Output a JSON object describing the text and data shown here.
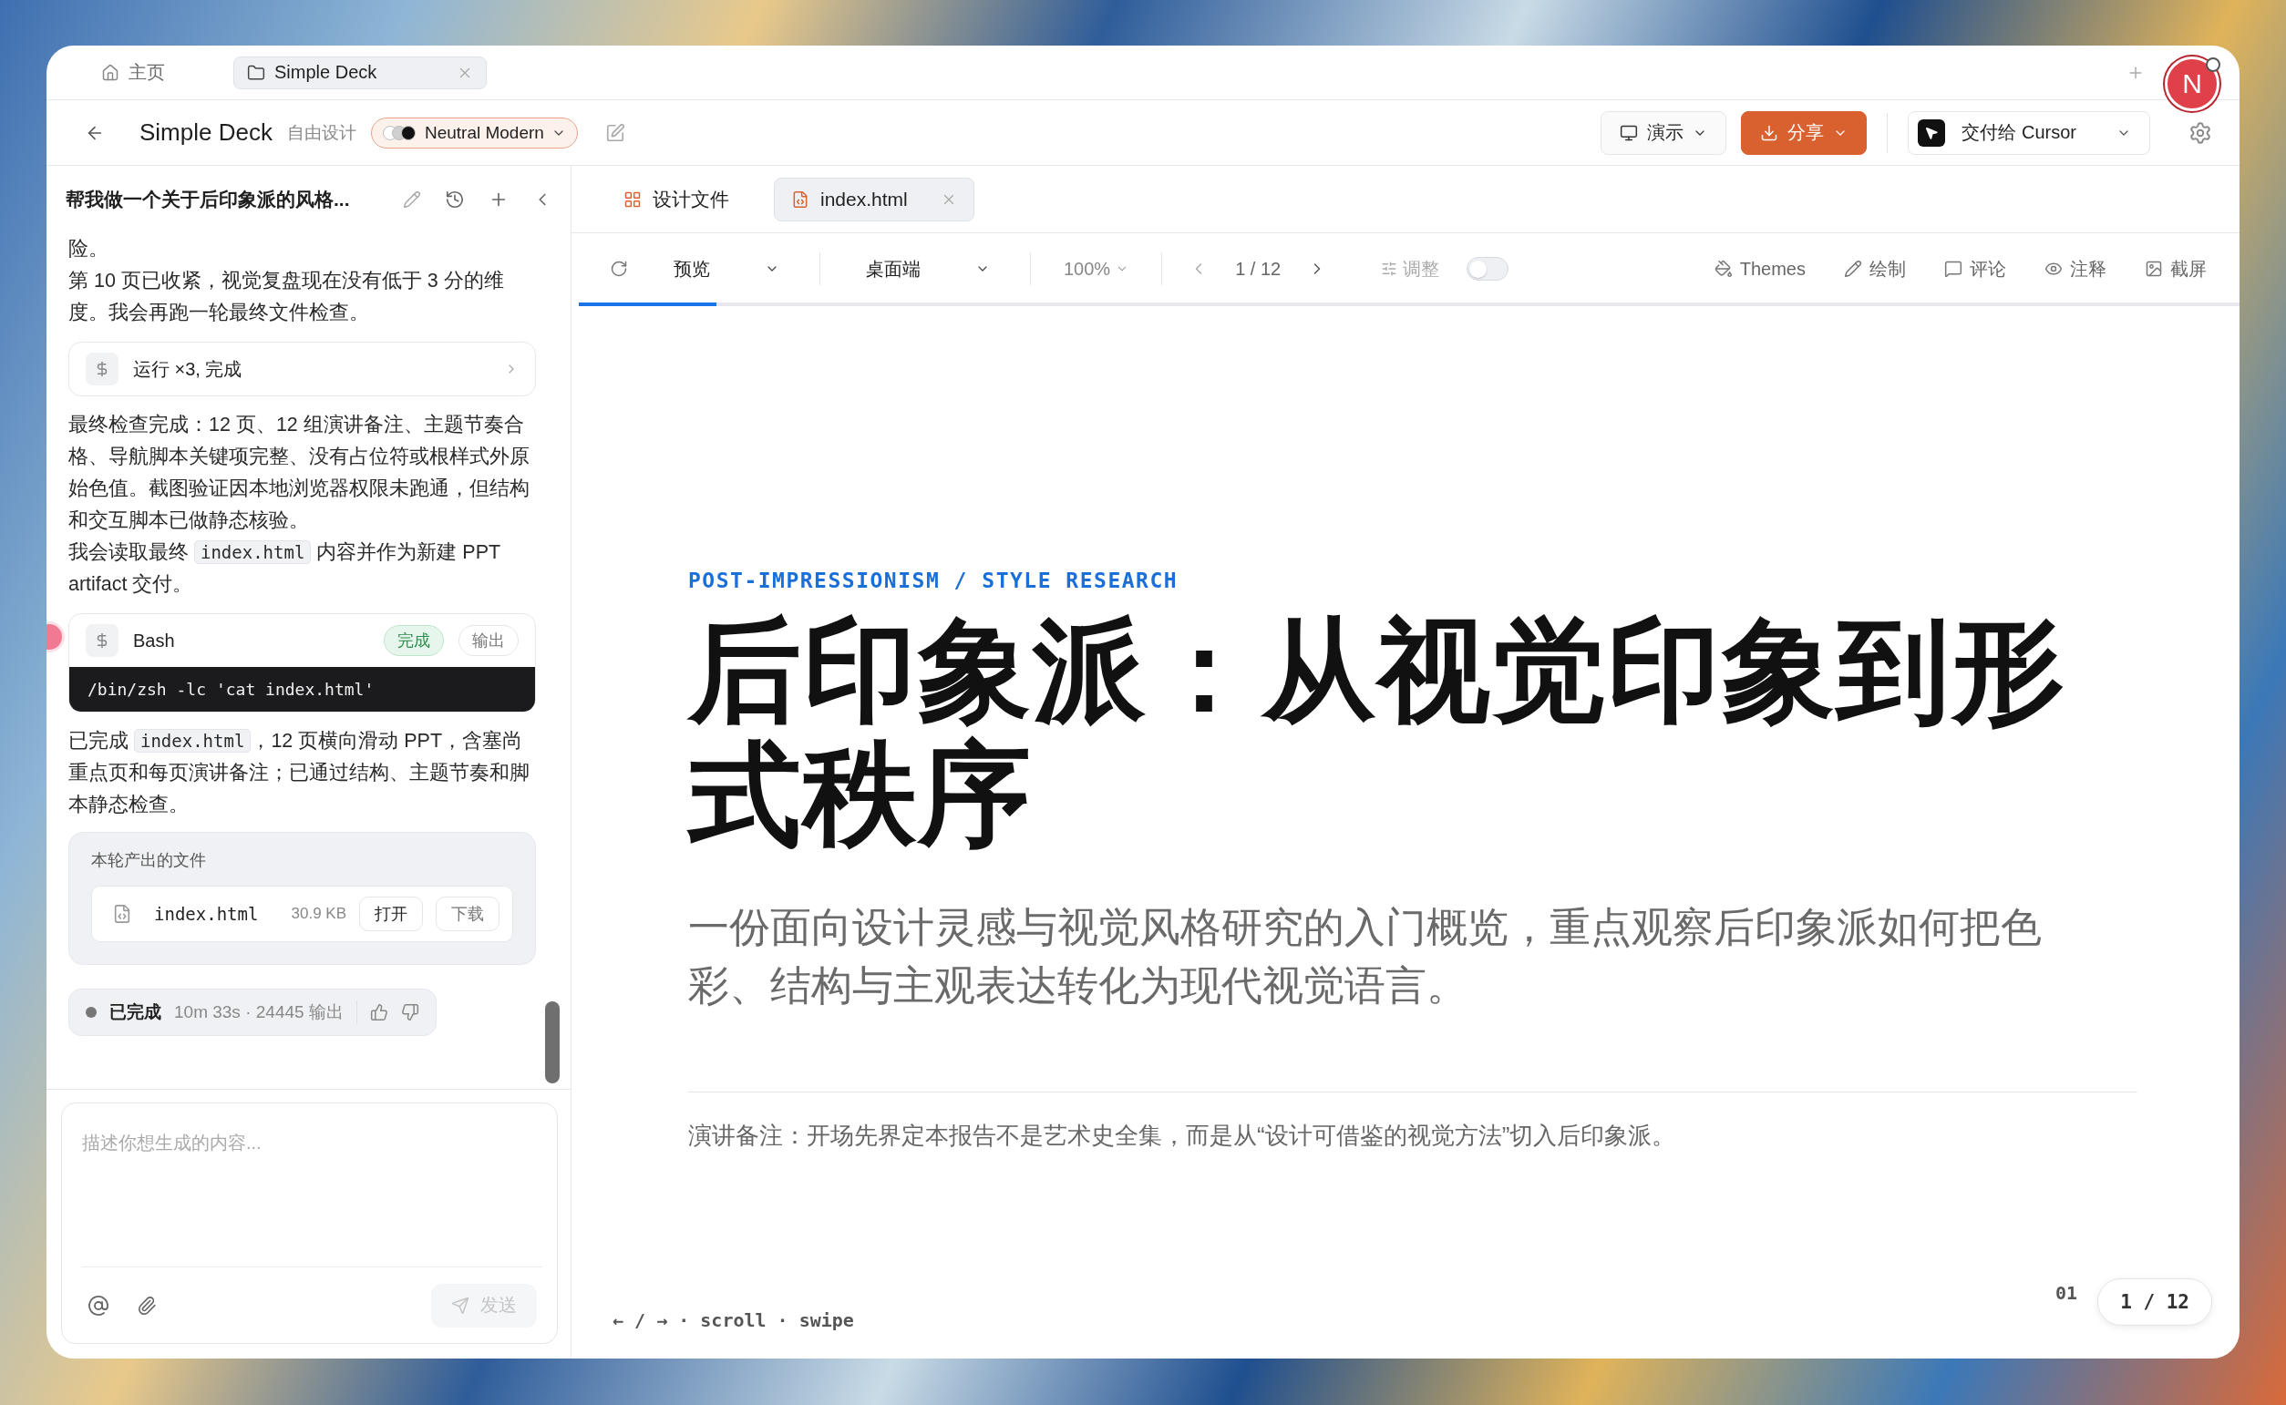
{
  "browser_tabs": [
    {
      "label": "主页",
      "selected": false
    },
    {
      "label": "Simple Deck",
      "selected": true
    }
  ],
  "header": {
    "title": "Simple Deck",
    "mode": "自由设计",
    "theme": {
      "name": "Neutral Modern",
      "swatches": [
        {
          "color": "#ffffff"
        },
        {
          "color": "#cfcfcf"
        },
        {
          "color": "#111111"
        }
      ]
    },
    "present": {
      "label": "演示"
    },
    "share": {
      "label": "分享"
    },
    "deliver": {
      "label": "交付给 Cursor"
    },
    "avatar": "N"
  },
  "chat": {
    "title": "帮我做一个关于后印象派的风格...",
    "messages": [
      {
        "kind": "text",
        "parts": [
          {
            "kind": "text",
            "text": "险。"
          }
        ]
      },
      {
        "kind": "text",
        "parts": [
          {
            "kind": "text",
            "text": "第 10 页已收紧，视觉复盘现在没有低于 3 分的维度。我会再跑一轮最终文件检查。"
          }
        ]
      },
      {
        "kind": "tool",
        "label": "运行 ×3, 完成"
      },
      {
        "kind": "text",
        "parts": [
          {
            "kind": "text",
            "text": "最终检查完成：12 页、12 组演讲备注、主题节奏合格、导航脚本关键项完整、没有占位符或根样式外原始色值。截图验证因本地浏览器权限未跑通，但结构和交互脚本已做静态核验。"
          }
        ]
      },
      {
        "kind": "text",
        "parts": [
          {
            "kind": "text",
            "text": "我会读取最终 "
          },
          {
            "kind": "code",
            "text": "index.html"
          },
          {
            "kind": "text",
            "text": " 内容并作为新建 PPT artifact 交付。"
          }
        ]
      },
      {
        "kind": "bash",
        "label": "Bash",
        "status": "完成",
        "action": "输出",
        "command": "/bin/zsh -lc 'cat index.html'"
      },
      {
        "kind": "text",
        "parts": [
          {
            "kind": "text",
            "text": "已完成 "
          },
          {
            "kind": "code",
            "text": "index.html"
          },
          {
            "kind": "text",
            "text": "，12 页横向滑动 PPT，含塞尚重点页和每页演讲备注；已通过结构、主题节奏和脚本静态检查。"
          }
        ]
      },
      {
        "kind": "files",
        "title": "本轮产出的文件",
        "files": [
          {
            "name": "index.html",
            "size": "30.9 KB",
            "actions": [
              "打开",
              "下载"
            ]
          }
        ]
      },
      {
        "kind": "status",
        "label": "已完成",
        "meta": "10m 33s · 24445 输出"
      }
    ],
    "composer": {
      "placeholder": "描述你想生成的内容...",
      "send": {
        "label": "发送",
        "disabled": true
      }
    }
  },
  "editor": {
    "tabs": [
      {
        "label": "设计文件",
        "selected": false
      },
      {
        "label": "index.html",
        "selected": true
      }
    ],
    "toolbar": {
      "view": "预览",
      "device": "桌面端",
      "zoom": "100%",
      "pager": "1 / 12",
      "adjust": {
        "label": "调整",
        "on": false
      },
      "tools": [
        {
          "label": "Themes"
        },
        {
          "label": "绘制"
        },
        {
          "label": "评论"
        },
        {
          "label": "注释"
        },
        {
          "label": "截屏"
        }
      ],
      "load_progress": {
        "level": 0.083
      }
    },
    "slide": {
      "eyebrow": "POST-IMPRESSIONISM / STYLE RESEARCH",
      "headline": "后印象派：从视觉印象到形式秩序",
      "subtitle": "一份面向设计灵感与视觉风格研究的入门概览，重点观察后印象派如何把色彩、结构与主观表达转化为现代视觉语言。",
      "notes": "演讲备注：开场先界定本报告不是艺术史全集，而是从“设计可借鉴的视觉方法”切入后印象派。",
      "nav_hint": "← / → · scroll · swipe",
      "slide_number": "01",
      "counter": "1 / 12"
    }
  }
}
